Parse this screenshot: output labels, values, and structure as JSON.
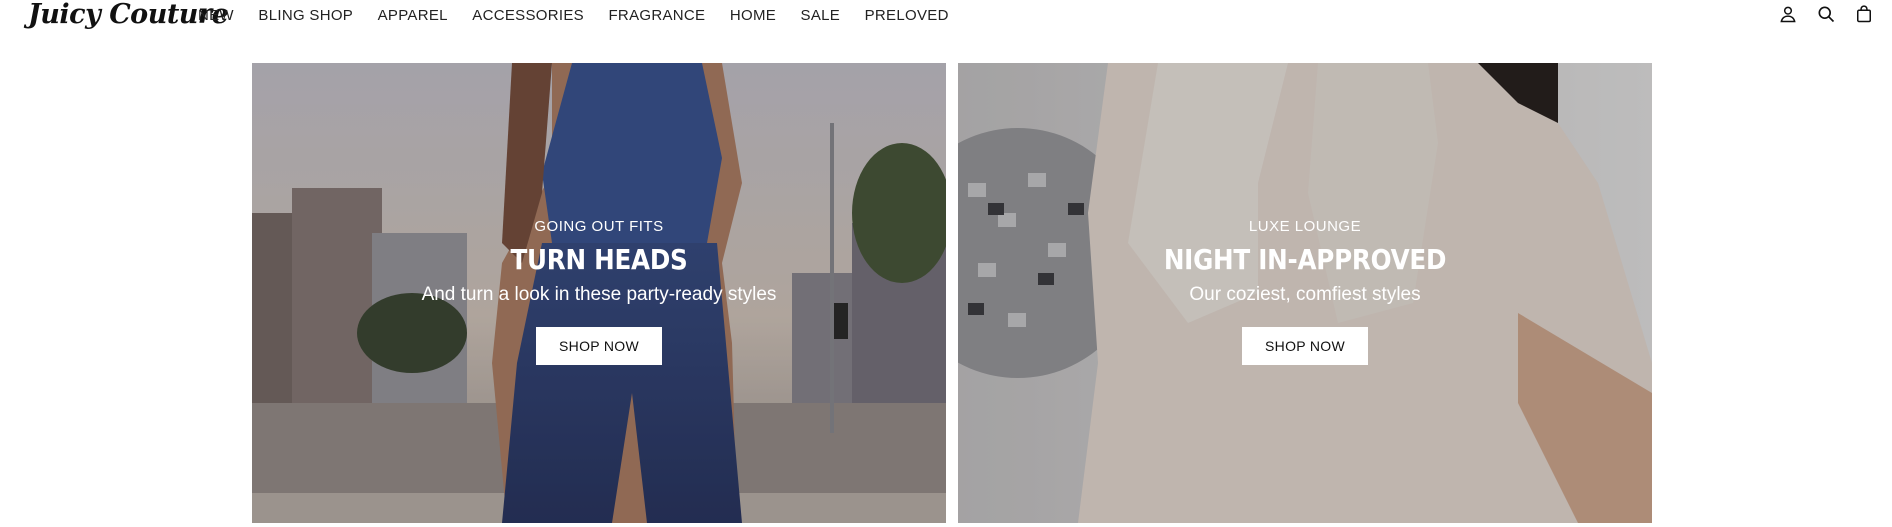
{
  "header": {
    "logo": "Juicy Couture",
    "nav": [
      "NEW",
      "BLING SHOP",
      "APPAREL",
      "ACCESSORIES",
      "FRAGRANCE",
      "HOME",
      "SALE",
      "PRELOVED"
    ],
    "icons": [
      "account-icon",
      "search-icon",
      "shopping-bag-icon"
    ]
  },
  "banners": [
    {
      "eyebrow": "GOING OUT FITS",
      "title": "TURN HEADS",
      "subtitle": "And turn a look in these party-ready styles",
      "button": "SHOP NOW"
    },
    {
      "eyebrow": "LUXE LOUNGE",
      "title": "NIGHT IN-APPROVED",
      "subtitle": "Our coziest, comfiest styles",
      "button": "SHOP NOW"
    }
  ],
  "colors": {
    "text": "#111111",
    "banner_text": "#ffffff",
    "button_bg": "#ffffff"
  }
}
